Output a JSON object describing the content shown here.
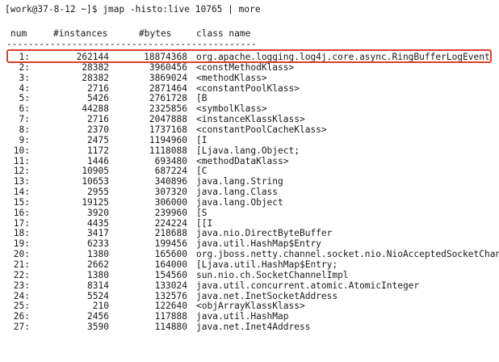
{
  "terminal": {
    "prompt": "[work@37-8-12 ~]$ jmap -histo:live 10765 | more",
    "headers": {
      "num": "num",
      "instances": "#instances",
      "bytes": "#bytes",
      "class_name": "class name"
    },
    "separator": "----------------------------------------------",
    "rows": [
      {
        "num": "1:",
        "instances": "262144",
        "bytes": "18874368",
        "class_name": "org.apache.logging.log4j.core.async.RingBufferLogEvent"
      },
      {
        "num": "2:",
        "instances": "28382",
        "bytes": "3960456",
        "class_name": "<constMethodKlass>"
      },
      {
        "num": "3:",
        "instances": "28382",
        "bytes": "3869024",
        "class_name": "<methodKlass>"
      },
      {
        "num": "4:",
        "instances": "2716",
        "bytes": "2871464",
        "class_name": "<constantPoolKlass>"
      },
      {
        "num": "5:",
        "instances": "5426",
        "bytes": "2761728",
        "class_name": "[B"
      },
      {
        "num": "6:",
        "instances": "44288",
        "bytes": "2325856",
        "class_name": "<symbolKlass>"
      },
      {
        "num": "7:",
        "instances": "2716",
        "bytes": "2047888",
        "class_name": "<instanceKlassKlass>"
      },
      {
        "num": "8:",
        "instances": "2370",
        "bytes": "1737168",
        "class_name": "<constantPoolCacheKlass>"
      },
      {
        "num": "9:",
        "instances": "2475",
        "bytes": "1194960",
        "class_name": "[I"
      },
      {
        "num": "10:",
        "instances": "1172",
        "bytes": "1118088",
        "class_name": "[Ljava.lang.Object;"
      },
      {
        "num": "11:",
        "instances": "1446",
        "bytes": "693480",
        "class_name": "<methodDataKlass>"
      },
      {
        "num": "12:",
        "instances": "10905",
        "bytes": "687224",
        "class_name": "[C"
      },
      {
        "num": "13:",
        "instances": "10653",
        "bytes": "340896",
        "class_name": "java.lang.String"
      },
      {
        "num": "14:",
        "instances": "2955",
        "bytes": "307320",
        "class_name": "java.lang.Class"
      },
      {
        "num": "15:",
        "instances": "19125",
        "bytes": "306000",
        "class_name": "java.lang.Object"
      },
      {
        "num": "16:",
        "instances": "3920",
        "bytes": "239960",
        "class_name": "[S"
      },
      {
        "num": "17:",
        "instances": "4435",
        "bytes": "224224",
        "class_name": "[[I"
      },
      {
        "num": "18:",
        "instances": "3417",
        "bytes": "218688",
        "class_name": "java.nio.DirectByteBuffer"
      },
      {
        "num": "19:",
        "instances": "6233",
        "bytes": "199456",
        "class_name": "java.util.HashMap$Entry"
      },
      {
        "num": "20:",
        "instances": "1380",
        "bytes": "165600",
        "class_name": "org.jboss.netty.channel.socket.nio.NioAcceptedSocketChannel"
      },
      {
        "num": "21:",
        "instances": "2662",
        "bytes": "164000",
        "class_name": "[Ljava.util.HashMap$Entry;"
      },
      {
        "num": "22:",
        "instances": "1380",
        "bytes": "154560",
        "class_name": "sun.nio.ch.SocketChannelImpl"
      },
      {
        "num": "23:",
        "instances": "8314",
        "bytes": "133024",
        "class_name": "java.util.concurrent.atomic.AtomicInteger"
      },
      {
        "num": "24:",
        "instances": "5524",
        "bytes": "132576",
        "class_name": "java.net.InetSocketAddress"
      },
      {
        "num": "25:",
        "instances": "210",
        "bytes": "122640",
        "class_name": "<objArrayKlassKlass>"
      },
      {
        "num": "26:",
        "instances": "2456",
        "bytes": "117888",
        "class_name": "java.util.HashMap"
      },
      {
        "num": "27:",
        "instances": "3590",
        "bytes": "114880",
        "class_name": "java.net.Inet4Address"
      }
    ],
    "highlight_color": "#d9412c"
  }
}
